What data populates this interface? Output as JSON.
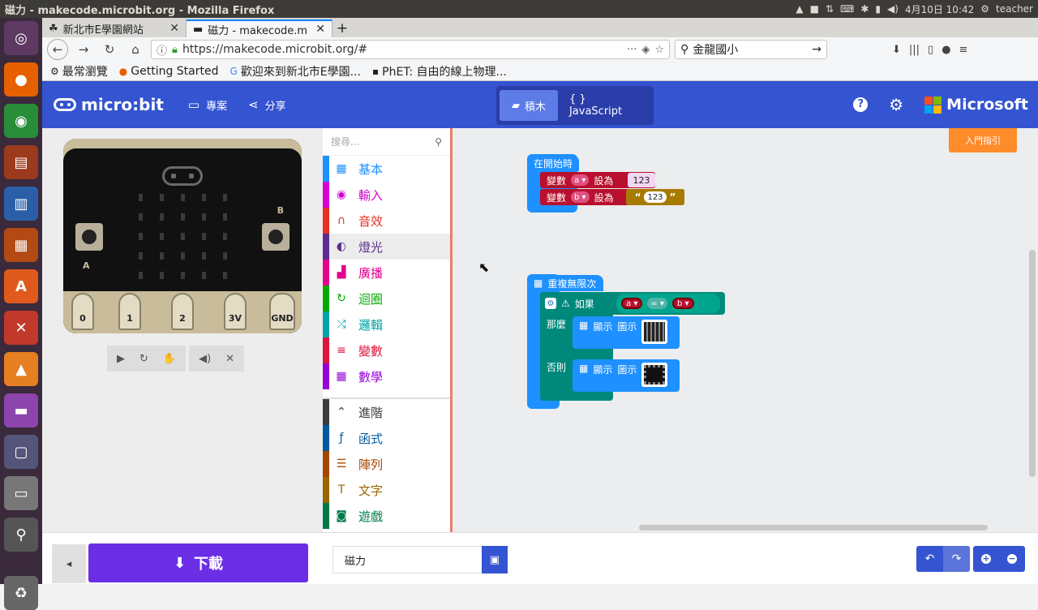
{
  "system": {
    "window_title": "磁力 - makecode.microbit.org - Mozilla Firefox",
    "clock": "4月10日 10:42",
    "user": "teacher"
  },
  "browser": {
    "tabs": [
      {
        "label": "新北市E學園網站"
      },
      {
        "label": "磁力 - makecode.m"
      }
    ],
    "url": "https://makecode.microbit.org/#",
    "search_value": "金龍國小",
    "bookmarks": [
      {
        "label": "最常瀏覽"
      },
      {
        "label": "Getting Started"
      },
      {
        "label": "歡迎來到新北市E學園..."
      },
      {
        "label": "PhET: 自由的線上物理..."
      }
    ]
  },
  "header": {
    "logo": "micro:bit",
    "projects": "專案",
    "share": "分享",
    "blocks_tab": "積木",
    "js_tab": "{ } JavaScript",
    "microsoft": "Microsoft"
  },
  "simulator": {
    "pins": [
      "0",
      "1",
      "2",
      "3V",
      "GND"
    ],
    "label_a": "A",
    "label_b": "B"
  },
  "toolbox": {
    "search_placeholder": "搜尋...",
    "categories": [
      {
        "label": "基本",
        "color": "#1e90ff"
      },
      {
        "label": "輸入",
        "color": "#d400d4"
      },
      {
        "label": "音效",
        "color": "#e63022"
      },
      {
        "label": "燈光",
        "color": "#5c2d91"
      },
      {
        "label": "廣播",
        "color": "#e3008c"
      },
      {
        "label": "迴圈",
        "color": "#00aa00"
      },
      {
        "label": "邏輯",
        "color": "#00a4a6"
      },
      {
        "label": "變數",
        "color": "#dc143c"
      },
      {
        "label": "數學",
        "color": "#9400d3"
      }
    ],
    "advanced": [
      {
        "label": "進階",
        "color": "#3c3c3c"
      },
      {
        "label": "函式",
        "color": "#005a9e"
      },
      {
        "label": "陣列",
        "color": "#a94400"
      },
      {
        "label": "文字",
        "color": "#996600"
      },
      {
        "label": "遊戲",
        "color": "#007a4b"
      }
    ]
  },
  "workspace": {
    "guide": "入門指引",
    "on_start": "在開始時",
    "var_label": "變數",
    "set_label": "設為",
    "var_a": "a",
    "var_b": "b",
    "value_num": "123",
    "value_str": "123",
    "forever": "重複無限次",
    "if_label": "如果",
    "then_label": "那麼",
    "else_label": "否則",
    "show_label": "顯示",
    "icon_label": "圖示",
    "eq": "="
  },
  "bottom": {
    "download": "下載",
    "project_name": "磁力"
  }
}
